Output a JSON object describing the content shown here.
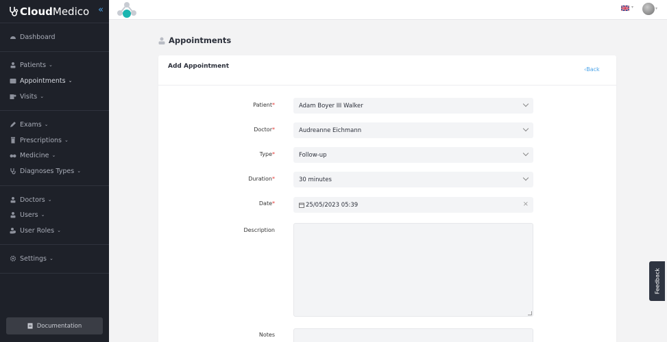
{
  "brand": {
    "part1": "Cloud",
    "part2": "Medico"
  },
  "sidebar": {
    "items": [
      {
        "label": "Dashboard",
        "icon": "dashboard-icon",
        "chevron": ""
      },
      {
        "label": "Patients",
        "icon": "patients-icon",
        "chevron": "⌄"
      },
      {
        "label": "Appointments",
        "icon": "appointments-icon",
        "chevron": "⌄"
      },
      {
        "label": "Visits",
        "icon": "visits-icon",
        "chevron": "⌄"
      },
      {
        "label": "Exams",
        "icon": "exams-icon",
        "chevron": "⌄"
      },
      {
        "label": "Prescriptions",
        "icon": "prescriptions-icon",
        "chevron": "⌄"
      },
      {
        "label": "Medicine",
        "icon": "medicine-icon",
        "chevron": "⌄"
      },
      {
        "label": "Diagnoses Types",
        "icon": "diagnoses-icon",
        "chevron": "⌄"
      },
      {
        "label": "Doctors",
        "icon": "doctors-icon",
        "chevron": "⌄"
      },
      {
        "label": "Users",
        "icon": "users-icon",
        "chevron": "⌄"
      },
      {
        "label": "User Roles",
        "icon": "user-roles-icon",
        "chevron": "⌄"
      },
      {
        "label": "Settings",
        "icon": "settings-icon",
        "chevron": "⌄"
      }
    ],
    "documentation_label": "Documentation"
  },
  "page": {
    "title": "Appointments"
  },
  "card": {
    "title": "Add Appointment",
    "back_label": "Back"
  },
  "form": {
    "patient": {
      "label": "Patient",
      "value": "Adam Boyer III Walker"
    },
    "doctor": {
      "label": "Doctor",
      "value": "Audreanne Eichmann"
    },
    "type": {
      "label": "Type",
      "value": "Follow-up"
    },
    "duration": {
      "label": "Duration",
      "value": "30 minutes"
    },
    "date": {
      "label": "Date",
      "value": "25/05/2023 05:39"
    },
    "description": {
      "label": "Description",
      "value": ""
    },
    "notes": {
      "label": "Notes",
      "value": ""
    },
    "required_mark": "*"
  },
  "feedback_label": "Feedback",
  "colors": {
    "sidebar_bg": "#1e2129",
    "accent": "#4aa3e8",
    "required": "#e53935",
    "logo_teal": "#1ab5b0"
  }
}
